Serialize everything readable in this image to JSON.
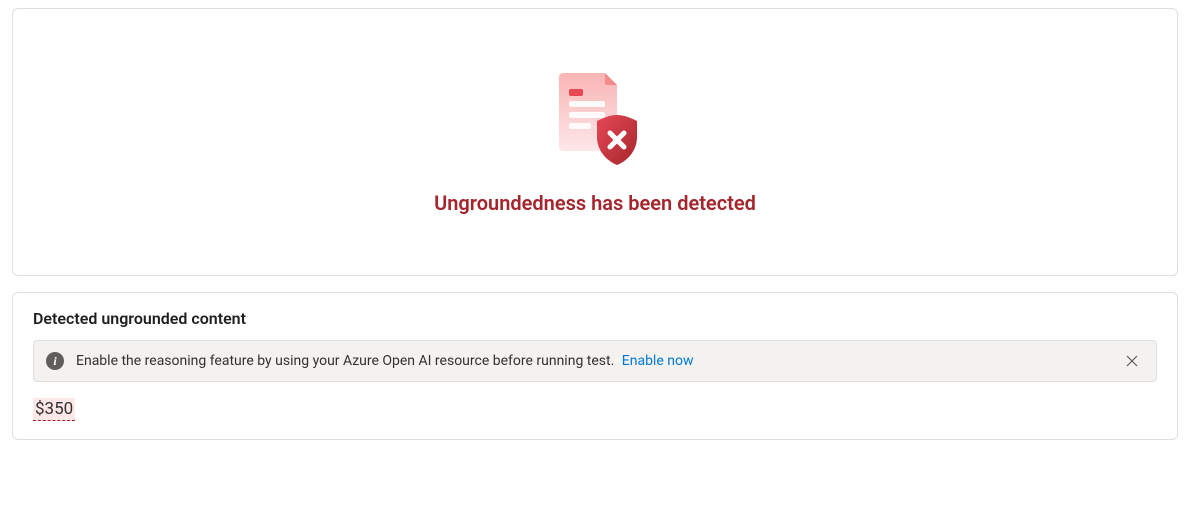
{
  "detection": {
    "title": "Ungroundedness has been detected"
  },
  "details": {
    "heading": "Detected ungrounded content",
    "info": {
      "message": "Enable the reasoning feature by using your Azure Open AI resource before running test.",
      "link_label": "Enable now"
    },
    "ungrounded_value": "$350"
  }
}
